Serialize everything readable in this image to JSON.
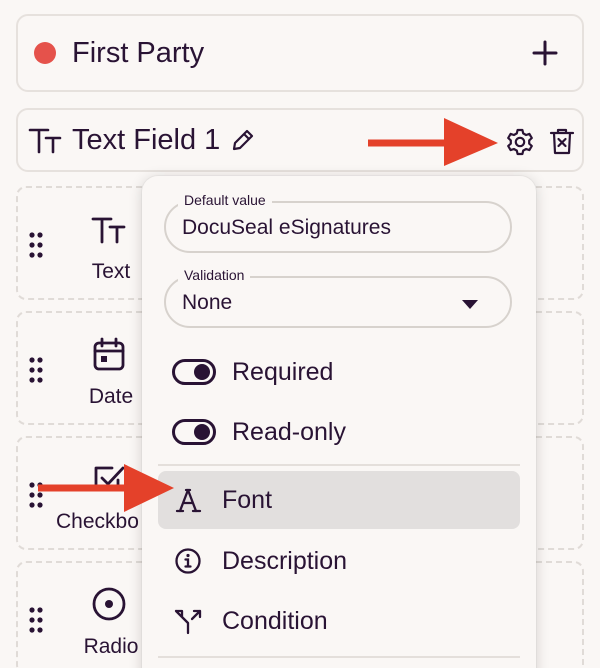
{
  "party": {
    "name": "First Party",
    "color": "#e5524b",
    "add_icon": "plus-icon"
  },
  "field": {
    "name": "Text Field 1",
    "icons": [
      "text-type-icon",
      "pencil-icon",
      "gear-icon",
      "trash-icon"
    ]
  },
  "field_types": [
    {
      "label": "Text",
      "icon": "text-type-icon"
    },
    {
      "label": "Date",
      "icon": "calendar-icon"
    },
    {
      "label": "Checkbo",
      "icon": "checkbox-icon"
    },
    {
      "label": "Radio",
      "icon": "radio-icon"
    }
  ],
  "dropdown": {
    "default_value": {
      "legend": "Default value",
      "value": "DocuSeal eSignatures"
    },
    "validation": {
      "legend": "Validation",
      "value": "None"
    },
    "toggles": [
      {
        "label": "Required",
        "checked": true
      },
      {
        "label": "Read-only",
        "checked": true
      }
    ],
    "items": [
      {
        "label": "Font",
        "icon": "font-icon",
        "highlighted": true
      },
      {
        "label": "Description",
        "icon": "info-icon",
        "highlighted": false
      },
      {
        "label": "Condition",
        "icon": "condition-icon",
        "highlighted": false
      }
    ]
  },
  "colors": {
    "text": "#291334",
    "arrow": "#e4412a",
    "border": "#e6e1dd",
    "highlight": "#e2dfde"
  }
}
